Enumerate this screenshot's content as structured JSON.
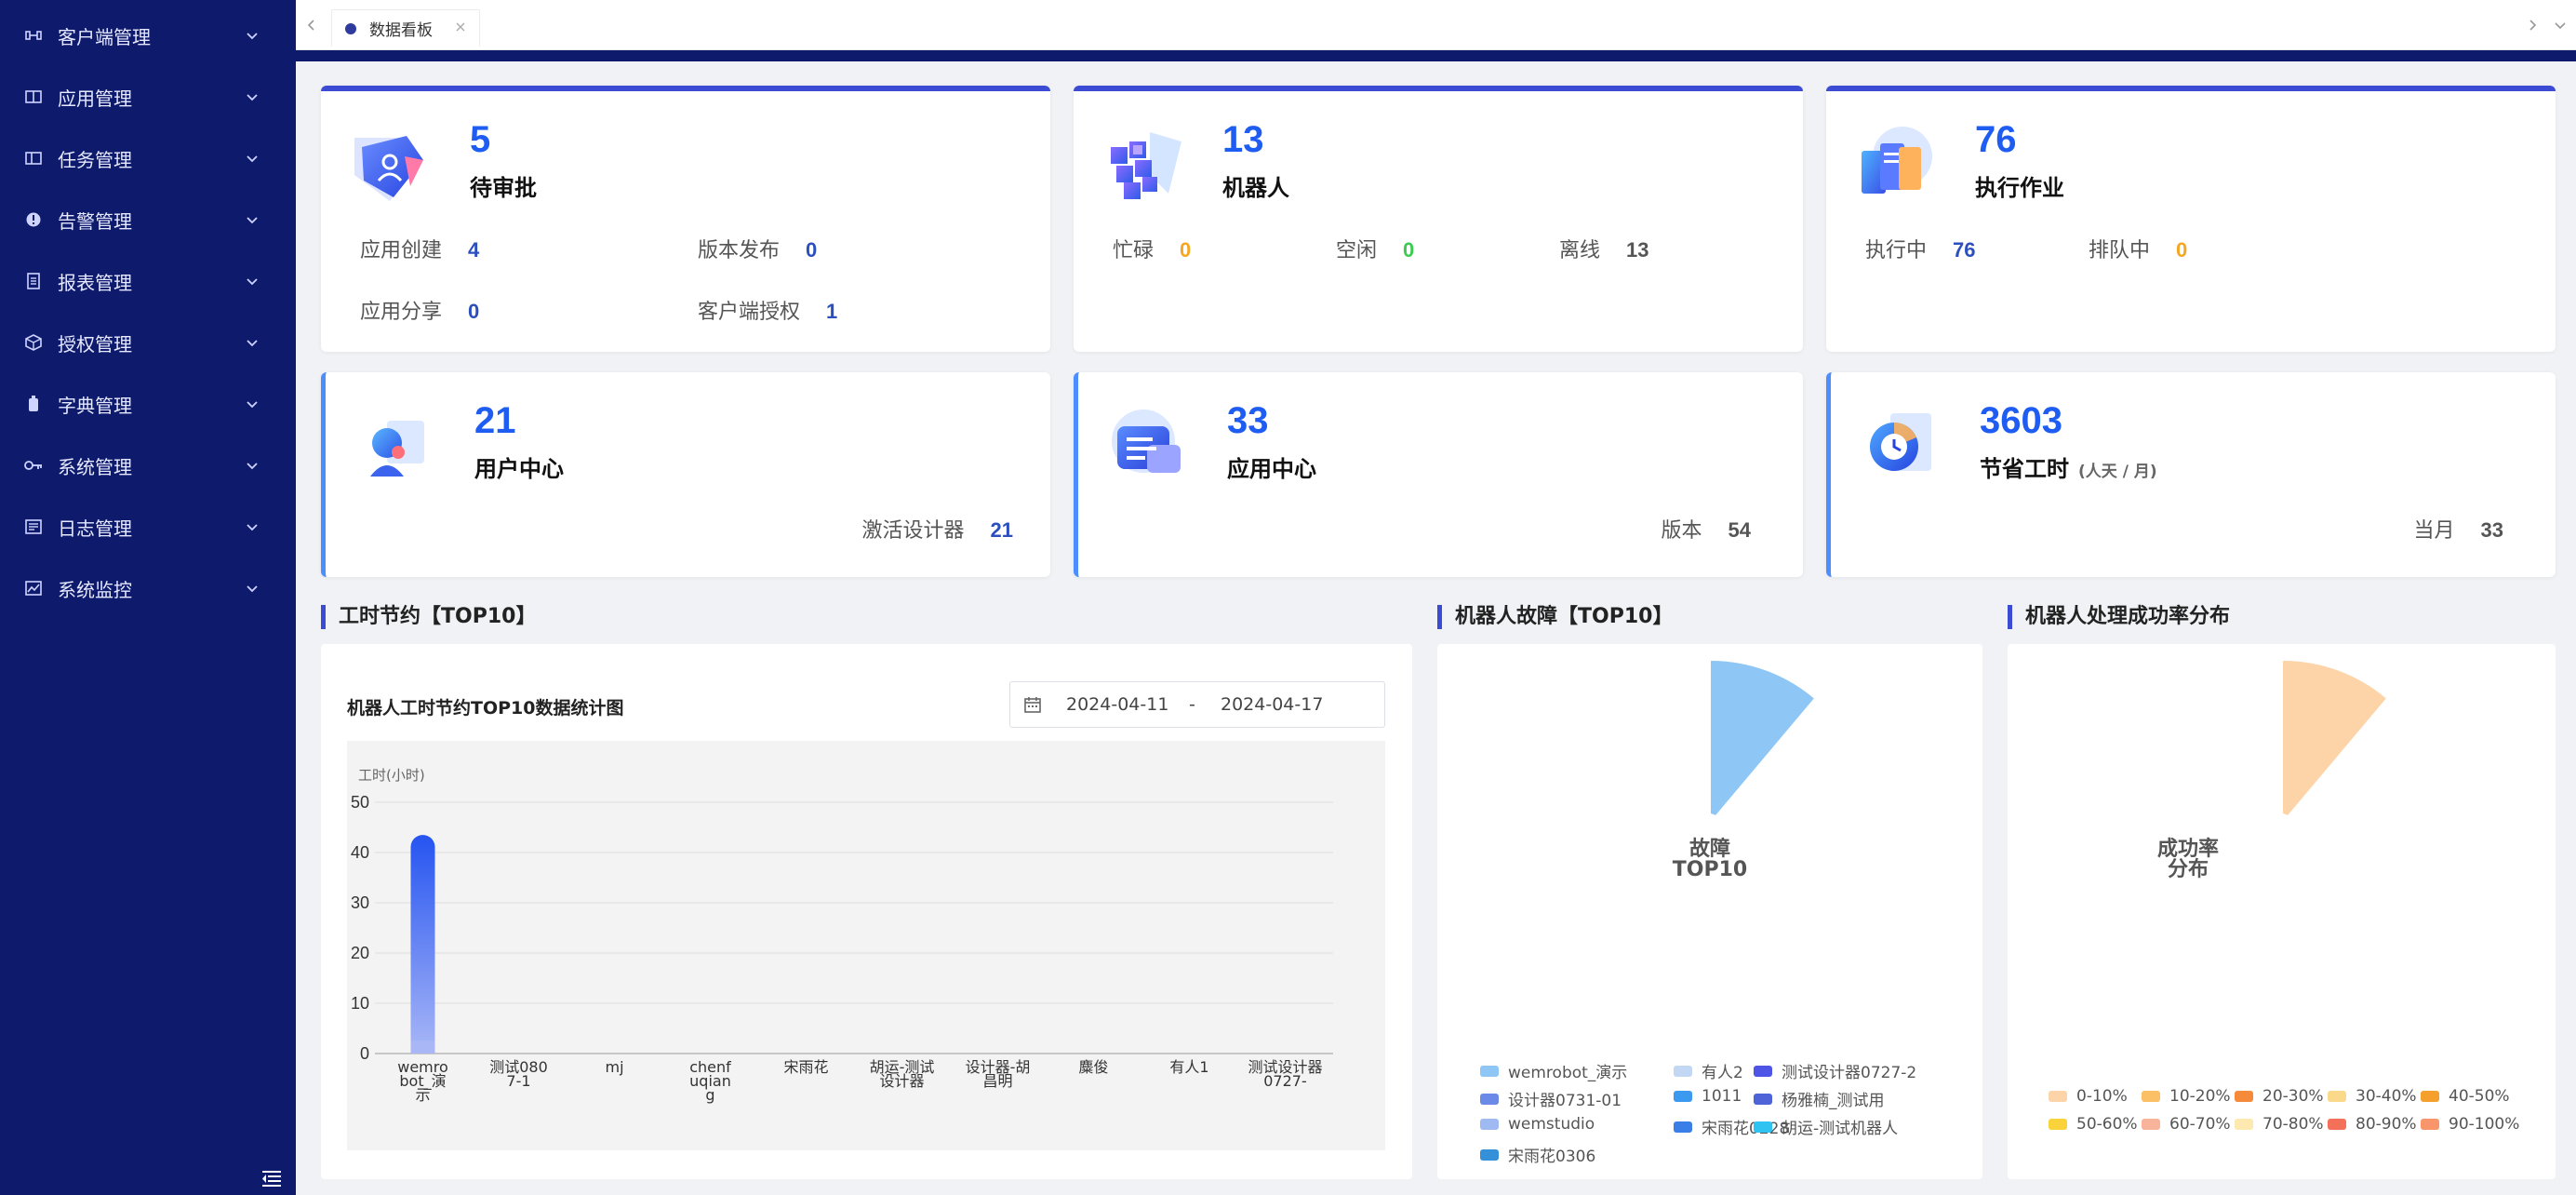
{
  "sidebar": {
    "items": [
      {
        "label": "客户端管理",
        "icon": "client-icon"
      },
      {
        "label": "应用管理",
        "icon": "app-icon"
      },
      {
        "label": "任务管理",
        "icon": "task-icon"
      },
      {
        "label": "告警管理",
        "icon": "alert-icon"
      },
      {
        "label": "报表管理",
        "icon": "report-icon"
      },
      {
        "label": "授权管理",
        "icon": "auth-icon"
      },
      {
        "label": "字典管理",
        "icon": "dictionary-icon"
      },
      {
        "label": "系统管理",
        "icon": "key-icon"
      },
      {
        "label": "日志管理",
        "icon": "log-icon"
      },
      {
        "label": "系统监控",
        "icon": "monitor-icon"
      }
    ]
  },
  "tabs": [
    {
      "label": "数据看板"
    }
  ],
  "cards": {
    "approval": {
      "value": "5",
      "title": "待审批",
      "stats": [
        {
          "label": "应用创建",
          "value": "4"
        },
        {
          "label": "版本发布",
          "value": "0"
        },
        {
          "label": "应用分享",
          "value": "0"
        },
        {
          "label": "客户端授权",
          "value": "1"
        }
      ]
    },
    "robots": {
      "value": "13",
      "title": "机器人",
      "stats": [
        {
          "label": "忙碌",
          "value": "0"
        },
        {
          "label": "空闲",
          "value": "0"
        },
        {
          "label": "离线",
          "value": "13"
        }
      ]
    },
    "jobs": {
      "value": "76",
      "title": "执行作业",
      "stats": [
        {
          "label": "执行中",
          "value": "76"
        },
        {
          "label": "排队中",
          "value": "0"
        }
      ]
    },
    "users": {
      "value": "21",
      "title": "用户中心",
      "stats": [
        {
          "label": "激活设计器",
          "value": "21"
        }
      ]
    },
    "apps": {
      "value": "33",
      "title": "应用中心",
      "stats": [
        {
          "label": "版本",
          "value": "54"
        }
      ]
    },
    "savings": {
      "value": "3603",
      "title": "节省工时",
      "unit": "(人天 / 月)",
      "stats": [
        {
          "label": "当月",
          "value": "33"
        }
      ]
    }
  },
  "sections": {
    "hours": "工时节约【TOP10】",
    "faults": "机器人故障【TOP10】",
    "success": "机器人处理成功率分布"
  },
  "hours_panel": {
    "chart_title": "机器人工时节约TOP10数据统计图",
    "date_start": "2024-04-11",
    "date_sep": "-",
    "date_end": "2024-04-17"
  },
  "chart_data": [
    {
      "type": "bar",
      "ylabel": "工时(小时)",
      "ylim": [
        0,
        50
      ],
      "yticks": [
        0,
        10,
        20,
        30,
        40,
        50
      ],
      "grid": true,
      "categories": [
        [
          "wemro",
          "bot_演",
          "示"
        ],
        [
          "测试080",
          "7-1"
        ],
        [
          "mj"
        ],
        [
          "chenf",
          "uqian",
          "g"
        ],
        [
          "宋雨花"
        ],
        [
          "胡运-测试",
          "设计器"
        ],
        [
          "设计器-胡",
          "昌明"
        ],
        [
          "麋俊"
        ],
        [
          "有人1"
        ],
        [
          "测试设计器",
          "0727-"
        ]
      ],
      "values": [
        43.5,
        0,
        0,
        0,
        0,
        0,
        0,
        0,
        0,
        0
      ],
      "bar_color_top": "#2554f0",
      "bar_color_bottom": "#a9b7f7"
    },
    {
      "type": "pie",
      "center_label": [
        "故障",
        "TOP10"
      ],
      "legend": "bottom",
      "slices": [
        {
          "name": "wemrobot_演示",
          "value": 1,
          "color": "#8ec6f5"
        },
        {
          "name": "有人2",
          "value": 0,
          "color": "#c2d7f3"
        },
        {
          "name": "测试设计器0727-2",
          "value": 0,
          "color": "#4e55e6"
        },
        {
          "name": "设计器0731-01",
          "value": 0,
          "color": "#6b8ae8"
        },
        {
          "name": "1011",
          "value": 0,
          "color": "#3b9af0"
        },
        {
          "name": "杨雅楠_测试用",
          "value": 0,
          "color": "#4f63d9"
        },
        {
          "name": "wemstudio",
          "value": 0,
          "color": "#9fbaf2"
        },
        {
          "name": "宋雨花0228",
          "value": 0,
          "color": "#3a7fe8"
        },
        {
          "name": "胡运-测试机器人",
          "value": 0,
          "color": "#2ec3f0"
        },
        {
          "name": "宋雨花0306",
          "value": 0,
          "color": "#3490d8"
        }
      ]
    },
    {
      "type": "pie",
      "center_label": [
        "成功率",
        "分布"
      ],
      "legend": "bottom",
      "slices": [
        {
          "name": "0-10%",
          "value": 1,
          "color": "#fdd3a8"
        },
        {
          "name": "10-20%",
          "value": 0,
          "color": "#fbc066"
        },
        {
          "name": "20-30%",
          "value": 0,
          "color": "#f58a3a"
        },
        {
          "name": "30-40%",
          "value": 0,
          "color": "#fbd98a"
        },
        {
          "name": "40-50%",
          "value": 0,
          "color": "#f5a02c"
        },
        {
          "name": "50-60%",
          "value": 0,
          "color": "#fad33b"
        },
        {
          "name": "60-70%",
          "value": 0,
          "color": "#f8b49a"
        },
        {
          "name": "70-80%",
          "value": 0,
          "color": "#fde8b0"
        },
        {
          "name": "80-90%",
          "value": 0,
          "color": "#f57058"
        },
        {
          "name": "90-100%",
          "value": 0,
          "color": "#f8956a"
        }
      ]
    }
  ],
  "colors": {
    "sidebar_bg": "#0e1a6c",
    "accent": "#3b4bd3",
    "number_blue": "#1e5cf2"
  }
}
